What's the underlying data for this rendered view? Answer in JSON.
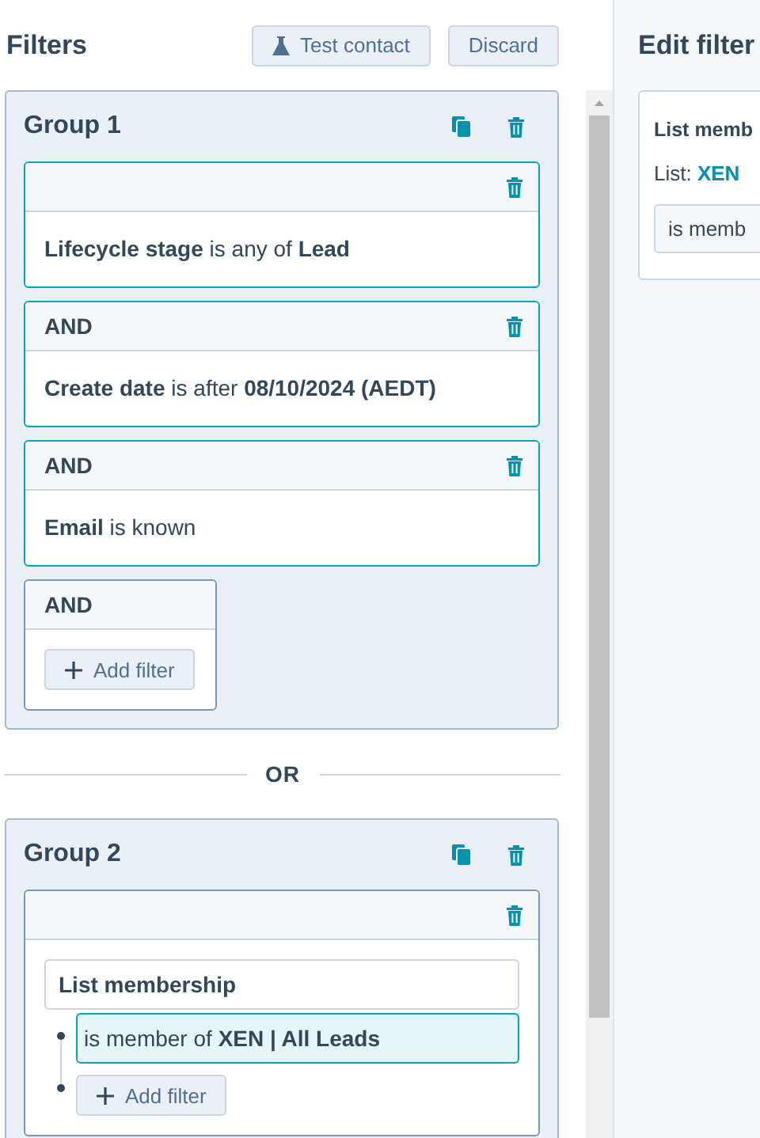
{
  "header": {
    "title": "Filters",
    "buttons": [
      {
        "label": "Test contact",
        "kind": "test"
      },
      {
        "label": "Discard",
        "kind": "plain"
      }
    ]
  },
  "groups": [
    {
      "title": "Group 1",
      "filters": [
        {
          "kind": "condition",
          "highlighted": true,
          "text": "**Lifecycle stage** is any of **Lead**"
        },
        {
          "kind": "condition",
          "connector": "AND",
          "highlighted": true,
          "text": "**Create date** is after **08/10/2024 (AEDT)**"
        },
        {
          "kind": "condition",
          "connector": "AND",
          "highlighted": true,
          "text": "**Email** is known"
        },
        {
          "kind": "add",
          "connector": "AND",
          "button": "Add filter"
        }
      ]
    },
    {
      "title": "Group 2",
      "filters": [
        {
          "kind": "list",
          "highlighted": false,
          "property": "List membership",
          "items": [
            {
              "text": "is member of **XEN | All Leads**",
              "selected": true
            }
          ],
          "button": "Add filter"
        }
      ]
    }
  ],
  "separator": "OR",
  "edit_panel": {
    "title": "Edit filter",
    "heading": "List memb",
    "list_text": "List: **XEN**",
    "field_value": "is memb"
  }
}
